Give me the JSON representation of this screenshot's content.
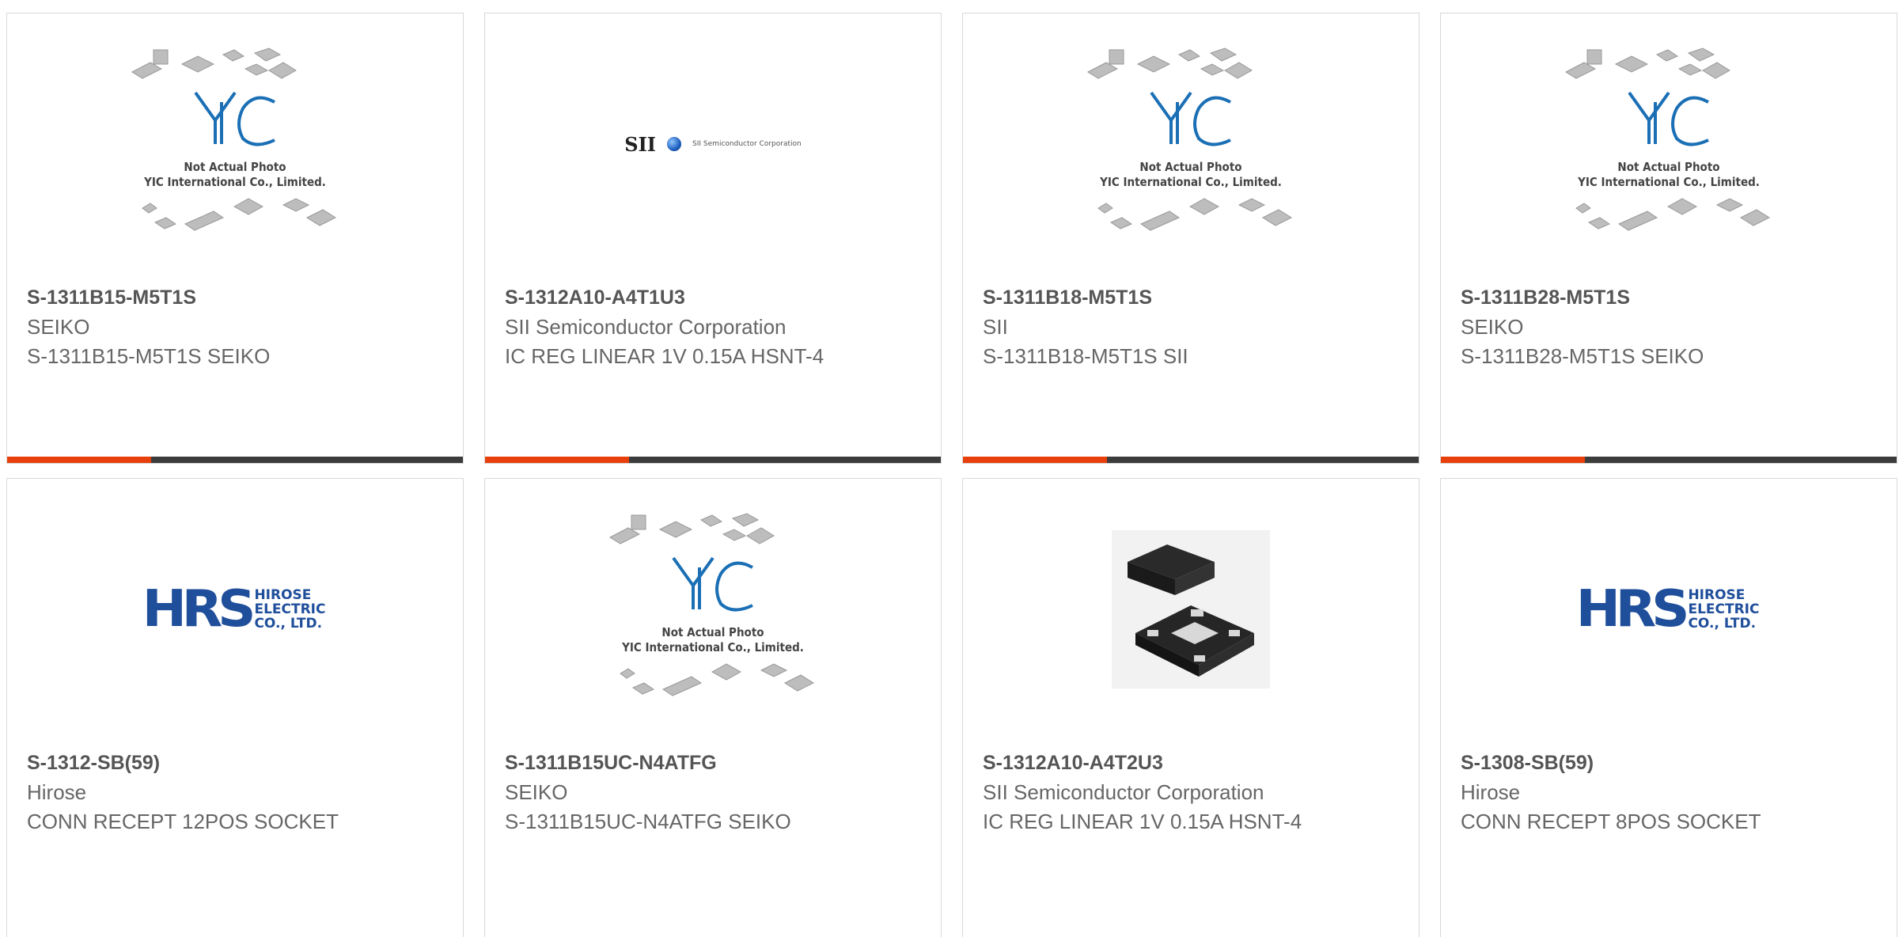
{
  "products": [
    {
      "part_number": "S-1311B15-M5T1S",
      "manufacturer": "SEIKO",
      "description": "S-1311B15-M5T1S SEIKO",
      "image": "yic-placeholder"
    },
    {
      "part_number": "S-1312A10-A4T1U3",
      "manufacturer": "SII Semiconductor Corporation",
      "description": "IC REG LINEAR 1V 0.15A HSNT-4",
      "image": "sii-logo"
    },
    {
      "part_number": "S-1311B18-M5T1S",
      "manufacturer": "SII",
      "description": "S-1311B18-M5T1S SII",
      "image": "yic-placeholder"
    },
    {
      "part_number": "S-1311B28-M5T1S",
      "manufacturer": "SEIKO",
      "description": "S-1311B28-M5T1S SEIKO",
      "image": "yic-placeholder"
    },
    {
      "part_number": "S-1312-SB(59)",
      "manufacturer": "Hirose",
      "description": "CONN RECEPT 12POS SOCKET",
      "image": "hrs-logo"
    },
    {
      "part_number": "S-1311B15UC-N4ATFG",
      "manufacturer": "SEIKO",
      "description": "S-1311B15UC-N4ATFG SEIKO",
      "image": "yic-placeholder"
    },
    {
      "part_number": "S-1312A10-A4T2U3",
      "manufacturer": "SII Semiconductor Corporation",
      "description": "IC REG LINEAR 1V 0.15A HSNT-4",
      "image": "chip-photo"
    },
    {
      "part_number": "S-1308-SB(59)",
      "manufacturer": "Hirose",
      "description": "CONN RECEPT 8POS SOCKET",
      "image": "hrs-logo"
    }
  ],
  "placeholder": {
    "line1": "Not Actual Photo",
    "line2": "YIC International Co., Limited.",
    "logo_text": "YIC"
  },
  "sii_logo": {
    "mark": "SII",
    "name": "SII Semiconductor Corporation"
  },
  "hrs_logo": {
    "mark": "HRS",
    "line1": "HIROSE",
    "line2": "ELECTRIC",
    "line3": "CO., LTD."
  },
  "colors": {
    "accent": "#e8400c",
    "bar": "#3c3c3c",
    "hrs_blue": "#1f4e9b",
    "yic_blue": "#1a6fb5"
  }
}
